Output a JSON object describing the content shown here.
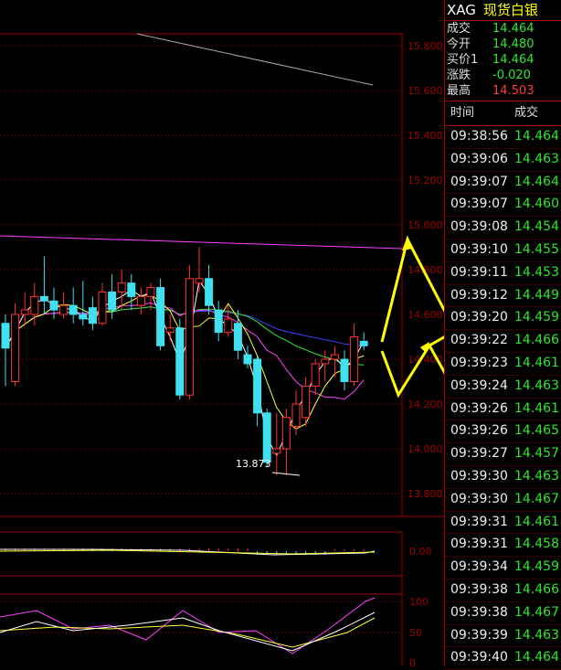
{
  "quote": {
    "code": "XAG",
    "name": "现货白银",
    "rows": [
      {
        "label": "成交",
        "value": "14.464",
        "color": "green"
      },
      {
        "label": "今开",
        "value": "14.480",
        "color": "green"
      },
      {
        "label": "买价1",
        "value": "14.464",
        "color": "green"
      },
      {
        "label": "涨跌",
        "value": "-0.020",
        "color": "green"
      },
      {
        "label": "最高",
        "value": "14.503",
        "color": "red"
      }
    ]
  },
  "ticks_header": {
    "time": "时间",
    "price": "成交"
  },
  "ticks": [
    {
      "time": "09:38:56",
      "price": "14.464"
    },
    {
      "time": "09:39:06",
      "price": "14.463"
    },
    {
      "time": "09:39:07",
      "price": "14.464"
    },
    {
      "time": "09:39:07",
      "price": "14.460"
    },
    {
      "time": "09:39:08",
      "price": "14.454"
    },
    {
      "time": "09:39:10",
      "price": "14.455"
    },
    {
      "time": "09:39:11",
      "price": "14.453"
    },
    {
      "time": "09:39:12",
      "price": "14.449"
    },
    {
      "time": "09:39:20",
      "price": "14.459"
    },
    {
      "time": "09:39:22",
      "price": "14.466"
    },
    {
      "time": "09:39:23",
      "price": "14.461"
    },
    {
      "time": "09:39:24",
      "price": "14.463"
    },
    {
      "time": "09:39:26",
      "price": "14.461"
    },
    {
      "time": "09:39:26",
      "price": "14.465"
    },
    {
      "time": "09:39:27",
      "price": "14.457"
    },
    {
      "time": "09:39:30",
      "price": "14.463"
    },
    {
      "time": "09:39:30",
      "price": "14.467"
    },
    {
      "time": "09:39:31",
      "price": "14.461"
    },
    {
      "time": "09:39:31",
      "price": "14.458"
    },
    {
      "time": "09:39:34",
      "price": "14.459"
    },
    {
      "time": "09:39:38",
      "price": "14.466"
    },
    {
      "time": "09:39:38",
      "price": "14.467"
    },
    {
      "time": "09:39:39",
      "price": "14.463"
    },
    {
      "time": "09:39:40",
      "price": "14.464"
    }
  ],
  "chart_data": {
    "type": "candlestick",
    "y_ticks": [
      "15.800",
      "15.600",
      "15.400",
      "15.200",
      "15.000",
      "14.800",
      "14.600",
      "14.400",
      "14.200",
      "14.000",
      "13.800"
    ],
    "ylim": [
      13.7,
      15.85
    ],
    "low_label": "13.873",
    "macd_ticks": [
      "0.00"
    ],
    "kdj_ticks": [
      "100",
      "50",
      "0"
    ],
    "candles": [
      {
        "o": 14.56,
        "c": 14.45,
        "h": 14.6,
        "l": 14.28,
        "up": false
      },
      {
        "o": 14.3,
        "c": 14.6,
        "h": 14.65,
        "l": 14.28,
        "up": true
      },
      {
        "o": 14.6,
        "c": 14.62,
        "h": 14.7,
        "l": 14.55,
        "up": true
      },
      {
        "o": 14.6,
        "c": 14.68,
        "h": 14.74,
        "l": 14.55,
        "up": true
      },
      {
        "o": 14.68,
        "c": 14.66,
        "h": 14.86,
        "l": 14.6,
        "up": false
      },
      {
        "o": 14.66,
        "c": 14.62,
        "h": 14.72,
        "l": 14.58,
        "up": false
      },
      {
        "o": 14.6,
        "c": 14.64,
        "h": 14.7,
        "l": 14.58,
        "up": true
      },
      {
        "o": 14.64,
        "c": 14.6,
        "h": 14.72,
        "l": 14.56,
        "up": false
      },
      {
        "o": 14.6,
        "c": 14.58,
        "h": 14.75,
        "l": 14.55,
        "up": false
      },
      {
        "o": 14.63,
        "c": 14.56,
        "h": 14.68,
        "l": 14.53,
        "up": false
      },
      {
        "o": 14.56,
        "c": 14.7,
        "h": 14.74,
        "l": 14.55,
        "up": true
      },
      {
        "o": 14.7,
        "c": 14.62,
        "h": 14.78,
        "l": 14.58,
        "up": false
      },
      {
        "o": 14.7,
        "c": 14.74,
        "h": 14.8,
        "l": 14.62,
        "up": true
      },
      {
        "o": 14.74,
        "c": 14.68,
        "h": 14.78,
        "l": 14.62,
        "up": false
      },
      {
        "o": 14.64,
        "c": 14.68,
        "h": 14.72,
        "l": 14.6,
        "up": true
      },
      {
        "o": 14.68,
        "c": 14.72,
        "h": 14.74,
        "l": 14.62,
        "up": true
      },
      {
        "o": 14.72,
        "c": 14.46,
        "h": 14.76,
        "l": 14.44,
        "up": false
      },
      {
        "o": 14.52,
        "c": 14.54,
        "h": 14.6,
        "l": 14.48,
        "up": true
      },
      {
        "o": 14.54,
        "c": 14.24,
        "h": 14.58,
        "l": 14.22,
        "up": false
      },
      {
        "o": 14.24,
        "c": 14.76,
        "h": 14.82,
        "l": 14.22,
        "up": true
      },
      {
        "o": 14.76,
        "c": 14.74,
        "h": 14.9,
        "l": 14.7,
        "up": true
      },
      {
        "o": 14.76,
        "c": 14.64,
        "h": 14.82,
        "l": 14.6,
        "up": false
      },
      {
        "o": 14.62,
        "c": 14.52,
        "h": 14.66,
        "l": 14.48,
        "up": false
      },
      {
        "o": 14.52,
        "c": 14.58,
        "h": 14.64,
        "l": 14.5,
        "up": true
      },
      {
        "o": 14.56,
        "c": 14.44,
        "h": 14.62,
        "l": 14.4,
        "up": false
      },
      {
        "o": 14.42,
        "c": 14.38,
        "h": 14.46,
        "l": 14.36,
        "up": false
      },
      {
        "o": 14.4,
        "c": 14.16,
        "h": 14.42,
        "l": 14.1,
        "up": false
      },
      {
        "o": 14.16,
        "c": 13.94,
        "h": 14.18,
        "l": 13.92,
        "up": false
      },
      {
        "o": 13.98,
        "c": 14.0,
        "h": 14.16,
        "l": 13.88,
        "up": true
      },
      {
        "o": 14.0,
        "c": 14.14,
        "h": 14.18,
        "l": 13.88,
        "up": true
      },
      {
        "o": 14.1,
        "c": 14.2,
        "h": 14.26,
        "l": 14.06,
        "up": true
      },
      {
        "o": 14.14,
        "c": 14.28,
        "h": 14.32,
        "l": 14.1,
        "up": true
      },
      {
        "o": 14.28,
        "c": 14.38,
        "h": 14.4,
        "l": 14.24,
        "up": true
      },
      {
        "o": 14.38,
        "c": 14.4,
        "h": 14.44,
        "l": 14.3,
        "up": true
      },
      {
        "o": 14.4,
        "c": 14.42,
        "h": 14.46,
        "l": 14.32,
        "up": true
      },
      {
        "o": 14.4,
        "c": 14.3,
        "h": 14.44,
        "l": 14.26,
        "up": false
      },
      {
        "o": 14.3,
        "c": 14.5,
        "h": 14.56,
        "l": 14.28,
        "up": true
      },
      {
        "o": 14.48,
        "c": 14.46,
        "h": 14.52,
        "l": 14.44,
        "up": false
      }
    ],
    "colors": {
      "up": "#ff3333",
      "down": "#3fe0f0",
      "ma5": "#ffffff",
      "ma10": "#ffff33",
      "ma20": "#ff40ff",
      "ma60": "#2ee62e",
      "ma120": "#4040ff",
      "grid": "#a00000"
    }
  }
}
